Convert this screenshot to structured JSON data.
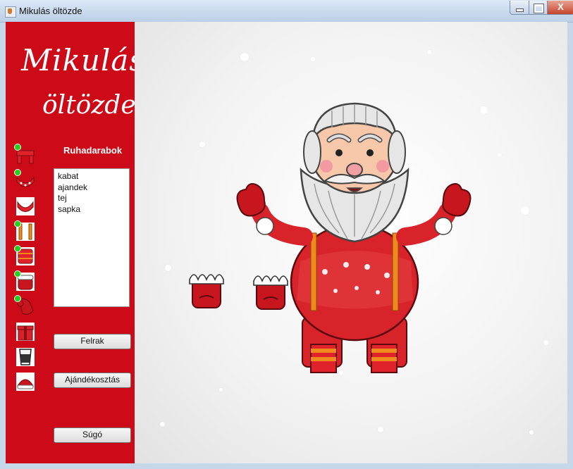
{
  "window": {
    "title": "Mikulás öltözde",
    "close_glyph": "X",
    "controls": [
      "minimize-icon",
      "maximize-icon",
      "close-icon"
    ]
  },
  "logo": {
    "line1": "Mikulás",
    "line2": "öltözde"
  },
  "sidebar": {
    "clothing_icons": [
      {
        "name": "scarf-icon",
        "equipped": true
      },
      {
        "name": "collar-icon",
        "equipped": true
      },
      {
        "name": "collar-alt-icon",
        "equipped": false
      },
      {
        "name": "suspenders-icon",
        "equipped": true
      },
      {
        "name": "belly-icon",
        "equipped": true
      },
      {
        "name": "mittens-icon",
        "equipped": true
      },
      {
        "name": "glove-icon",
        "equipped": true
      },
      {
        "name": "gift-icon",
        "equipped": false
      },
      {
        "name": "milk-glass-icon",
        "equipped": false
      },
      {
        "name": "hat-icon",
        "equipped": false
      }
    ]
  },
  "list": {
    "title": "Ruhadarabok",
    "items": [
      "kabat",
      "ajandek",
      "tej",
      "sapka"
    ]
  },
  "buttons": {
    "put_on": "Felrak",
    "gift_giving": "Ajándékosztás",
    "help": "Súgó"
  },
  "colors": {
    "sidebar_red": "#cd0a17",
    "santa_red": "#d8232a",
    "equipped_dot": "#22d21a"
  }
}
